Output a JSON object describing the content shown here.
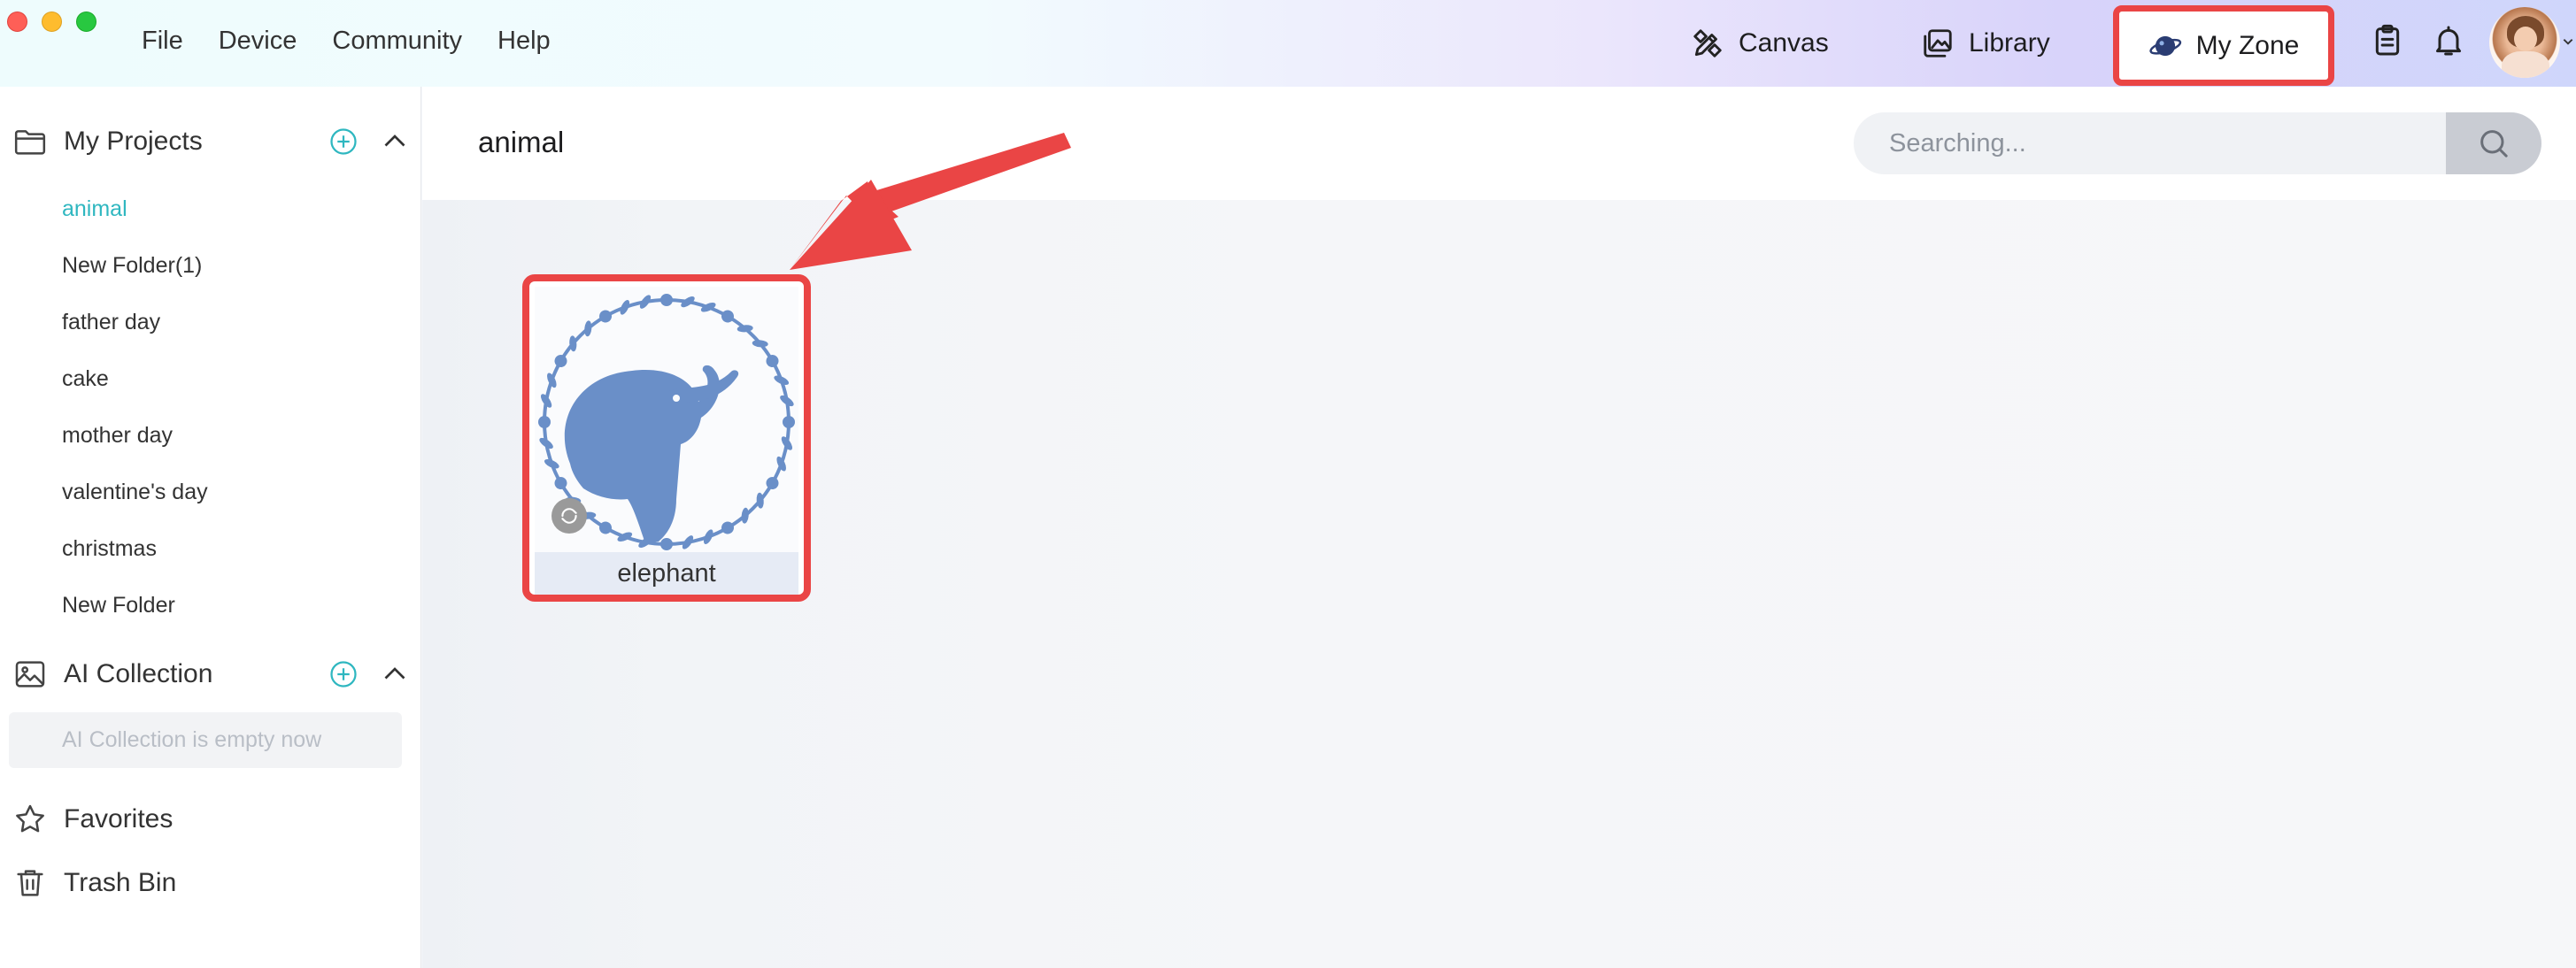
{
  "menu": {
    "file": "File",
    "device": "Device",
    "community": "Community",
    "help": "Help"
  },
  "nav": {
    "canvas": "Canvas",
    "library": "Library",
    "my_zone": "My Zone"
  },
  "sidebar": {
    "my_projects": "My Projects",
    "folders": [
      "animal",
      "New Folder(1)",
      "father day",
      "cake",
      "mother day",
      "valentine's day",
      "christmas",
      "New Folder"
    ],
    "active_folder": "animal",
    "ai_collection": "AI Collection",
    "ai_empty": "AI Collection is empty now",
    "favorites": "Favorites",
    "trash": "Trash Bin"
  },
  "main": {
    "breadcrumb": "animal",
    "search_placeholder": "Searching...",
    "project": {
      "name": "elephant"
    }
  },
  "colors": {
    "accent": "#2fb7c0",
    "highlight": "#ea4545",
    "elephant": "#6a8fc8"
  }
}
